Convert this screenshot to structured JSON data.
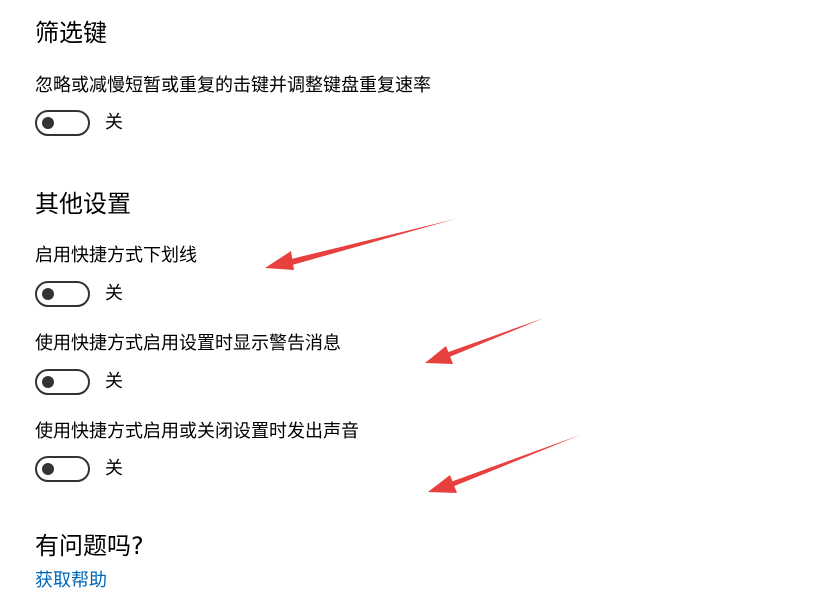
{
  "filter_keys": {
    "title": "筛选键",
    "description": "忽略或减慢短暂或重复的击键并调整键盘重复速率",
    "state_label": "关"
  },
  "other_settings": {
    "title": "其他设置",
    "items": [
      {
        "label": "启用快捷方式下划线",
        "state_label": "关"
      },
      {
        "label": "使用快捷方式启用设置时显示警告消息",
        "state_label": "关"
      },
      {
        "label": "使用快捷方式启用或关闭设置时发出声音",
        "state_label": "关"
      }
    ]
  },
  "help": {
    "title": "有问题吗?",
    "link_label": "获取帮助"
  },
  "colors": {
    "link": "#0067b8",
    "toggle_off": "#333333",
    "annotation_arrow": "#e8403f"
  }
}
